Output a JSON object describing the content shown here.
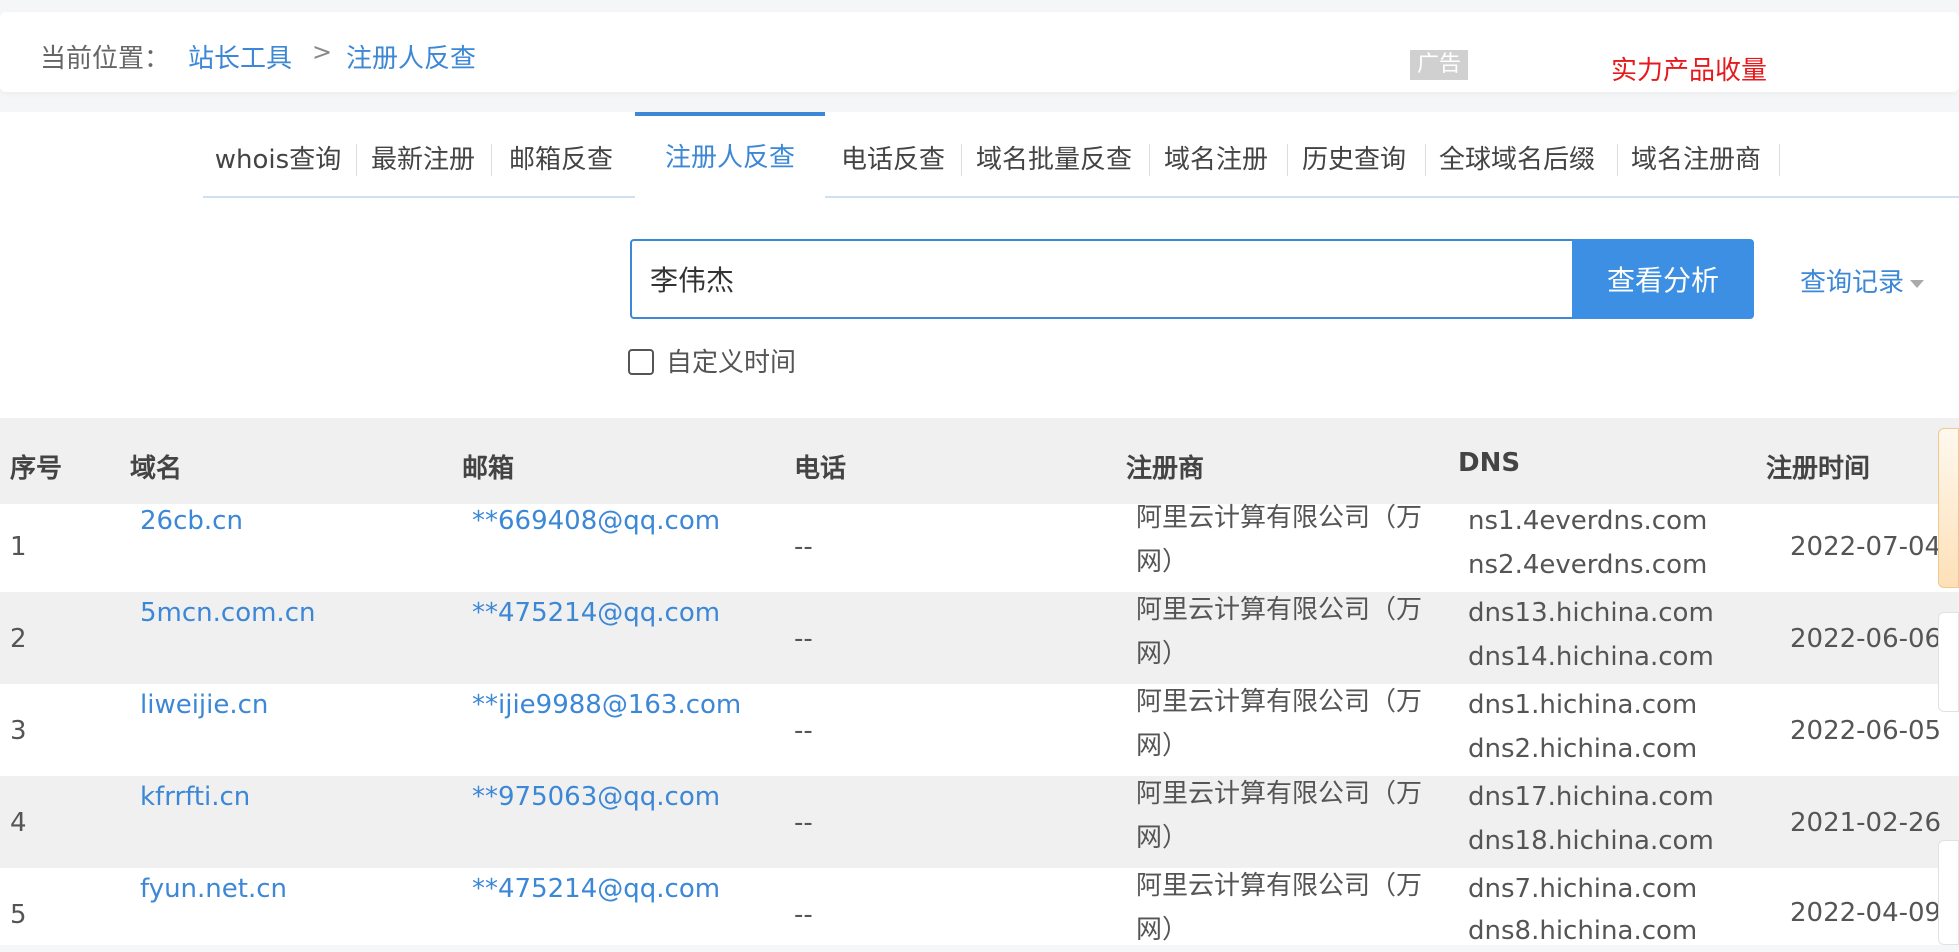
{
  "breadcrumb": {
    "prefix": "当前位置：",
    "items": [
      "站长工具",
      "注册人反查"
    ],
    "separator": ">"
  },
  "ad": {
    "tag": "广告",
    "promo_text": "实力产品收量"
  },
  "tabs": [
    "whois查询",
    "最新注册",
    "邮箱反查",
    "注册人反查",
    "电话反查",
    "域名批量反查",
    "域名注册",
    "历史查询",
    "全球域名后缀",
    "域名注册商"
  ],
  "active_tab": "注册人反查",
  "search": {
    "value": "李伟杰",
    "button_label": "查看分析",
    "history_label": "查询记录"
  },
  "custom_time_label": "自定义时间",
  "table": {
    "headers": [
      "序号",
      "域名",
      "邮箱",
      "电话",
      "注册商",
      "DNS",
      "注册时间"
    ],
    "rows": [
      {
        "index": "1",
        "domain": "26cb.cn",
        "email": "**669408@qq.com",
        "phone": "--",
        "registrar": "阿里云计算有限公司（万网）",
        "dns1": "ns1.4everdns.com",
        "dns2": "ns2.4everdns.com",
        "date": "2022-07-04"
      },
      {
        "index": "2",
        "domain": "5mcn.com.cn",
        "email": "**475214@qq.com",
        "phone": "--",
        "registrar": "阿里云计算有限公司（万网）",
        "dns1": "dns13.hichina.com",
        "dns2": "dns14.hichina.com",
        "date": "2022-06-06"
      },
      {
        "index": "3",
        "domain": "liweijie.cn",
        "email": "**ijie9988@163.com",
        "phone": "--",
        "registrar": "阿里云计算有限公司（万网）",
        "dns1": "dns1.hichina.com",
        "dns2": "dns2.hichina.com",
        "date": "2022-06-05"
      },
      {
        "index": "4",
        "domain": "kfrrfti.cn",
        "email": "**975063@qq.com",
        "phone": "--",
        "registrar": "阿里云计算有限公司（万网）",
        "dns1": "dns17.hichina.com",
        "dns2": "dns18.hichina.com",
        "date": "2021-02-26"
      },
      {
        "index": "5",
        "domain": "fyun.net.cn",
        "email": "**475214@qq.com",
        "phone": "--",
        "registrar": "阿里云计算有限公司（万网）",
        "dns1": "dns7.hichina.com",
        "dns2": "dns8.hichina.com",
        "date": "2022-04-09"
      }
    ]
  },
  "colors": {
    "accent": "#3c87d6",
    "button": "#3c8fe2",
    "promo": "#e8191c",
    "row_alt": "#f0f0f0"
  }
}
